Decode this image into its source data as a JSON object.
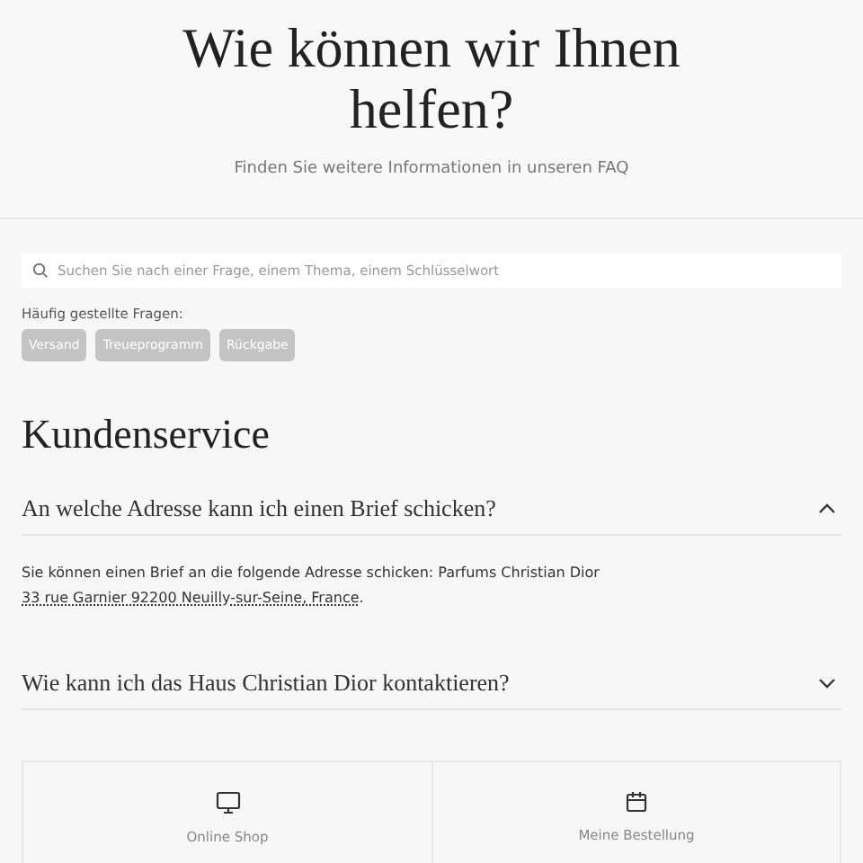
{
  "header": {
    "title": "Wie können wir Ihnen helfen?",
    "subtitle": "Finden Sie weitere Informationen in unseren FAQ"
  },
  "search": {
    "placeholder": "Suchen Sie nach einer Frage, einem Thema, einem Schlüsselwort"
  },
  "frequent": {
    "label": "Häufig gestellte Fragen:",
    "chips": [
      "Versand",
      "Treueprogramm",
      "Rückgabe"
    ]
  },
  "section": {
    "title": "Kundenservice"
  },
  "faq": [
    {
      "question": "An welche Adresse kann ich einen Brief schicken?",
      "expanded": true,
      "answer": {
        "text": "Sie können einen Brief an die folgende Adresse schicken: Parfums Christian Dior",
        "link": "33 rue Garnier 92200 Neuilly-sur-Seine, France",
        "after": "."
      }
    },
    {
      "question": "Wie kann ich das Haus Christian Dior kontaktieren?",
      "expanded": false
    }
  ],
  "cards": [
    {
      "kind": "monitor",
      "label": "Online Shop"
    },
    {
      "kind": "calendar",
      "label": "Meine Bestellung"
    }
  ]
}
